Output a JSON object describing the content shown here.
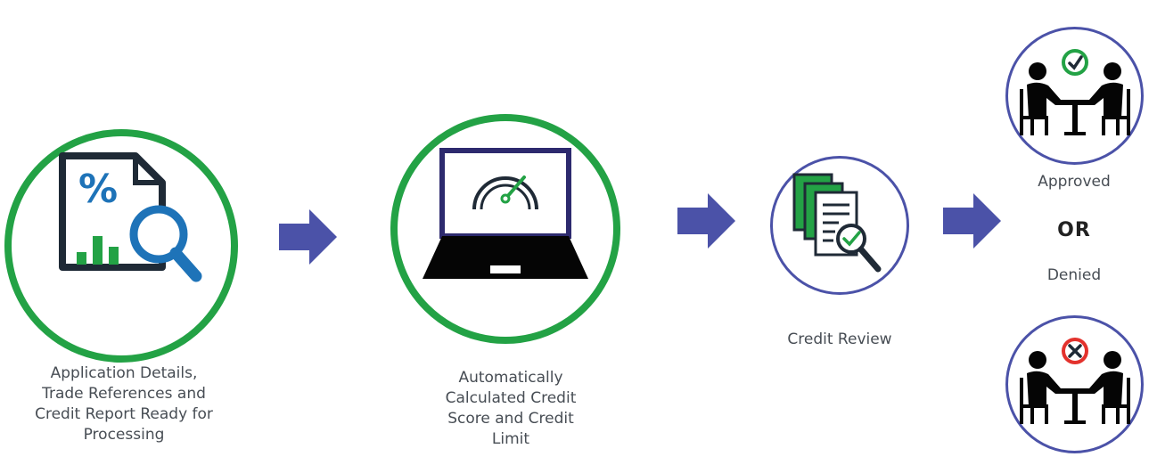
{
  "steps": [
    {
      "label_lines": [
        "Application Details,",
        "Trade References and",
        "Credit Report Ready for",
        "Processing"
      ]
    },
    {
      "label_lines": [
        "Automatically",
        "Calculated Credit",
        "Score and Credit",
        "Limit"
      ]
    },
    {
      "label_lines": [
        "Credit Review"
      ]
    }
  ],
  "outcome": {
    "approved": "Approved",
    "or": "OR",
    "denied": "Denied"
  },
  "colors": {
    "green_ring": "#23a245",
    "blue_ring": "#4b52a8",
    "arrow": "#4b52a8",
    "icon_dark": "#1f2a36",
    "icon_blue": "#1e73b8",
    "denied_red": "#e3322d"
  },
  "icons": [
    "document-percent-magnifier-icon",
    "laptop-gauge-icon",
    "documents-review-icon",
    "meeting-approved-icon",
    "meeting-denied-icon",
    "arrow-right-icon"
  ]
}
